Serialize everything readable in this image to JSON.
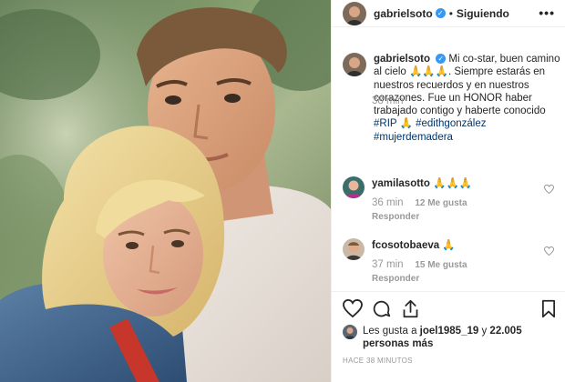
{
  "header": {
    "username": "gabrielsoto",
    "verified_glyph": "✓",
    "separator": "•",
    "follow_status": "Siguiendo",
    "more_glyph": "•••"
  },
  "caption": {
    "username": "gabrielsoto",
    "text": "Mi co-star, buen camino al cielo 🙏🙏🙏. Siempre estarás en nuestros recuerdos y en nuestros corazones. Fue un HONOR haber trabajado contigo y haberte conocido",
    "hashtag_rip": "#RIP",
    "emoji_after_rip": "🙏",
    "hashtag_name": "#edithgonzález",
    "hashtag_last": "#mujerdemadera",
    "time": "38 min"
  },
  "comments": [
    {
      "username": "yamilasotto",
      "text": "🙏🙏🙏",
      "time": "36 min",
      "likes": "12 Me gusta",
      "reply": "Responder"
    },
    {
      "username": "fcosotobaeva",
      "text": "🙏",
      "time": "37 min",
      "likes": "15 Me gusta",
      "reply": "Responder"
    }
  ],
  "likes": {
    "text_prefix": "Les gusta a",
    "liker": "joel1985_19",
    "text_mid": "y",
    "count": "22.005 personas más"
  },
  "posted_ago": "HACE 38 MINUTOS",
  "icons": [
    "more-options-icon",
    "verified-badge-icon",
    "heart-icon",
    "comment-icon",
    "share-icon",
    "bookmark-icon"
  ],
  "colors": {
    "verified_blue": "#3897f0",
    "hashtag_link": "#003569",
    "muted_text": "#999999",
    "border": "#efefef"
  }
}
